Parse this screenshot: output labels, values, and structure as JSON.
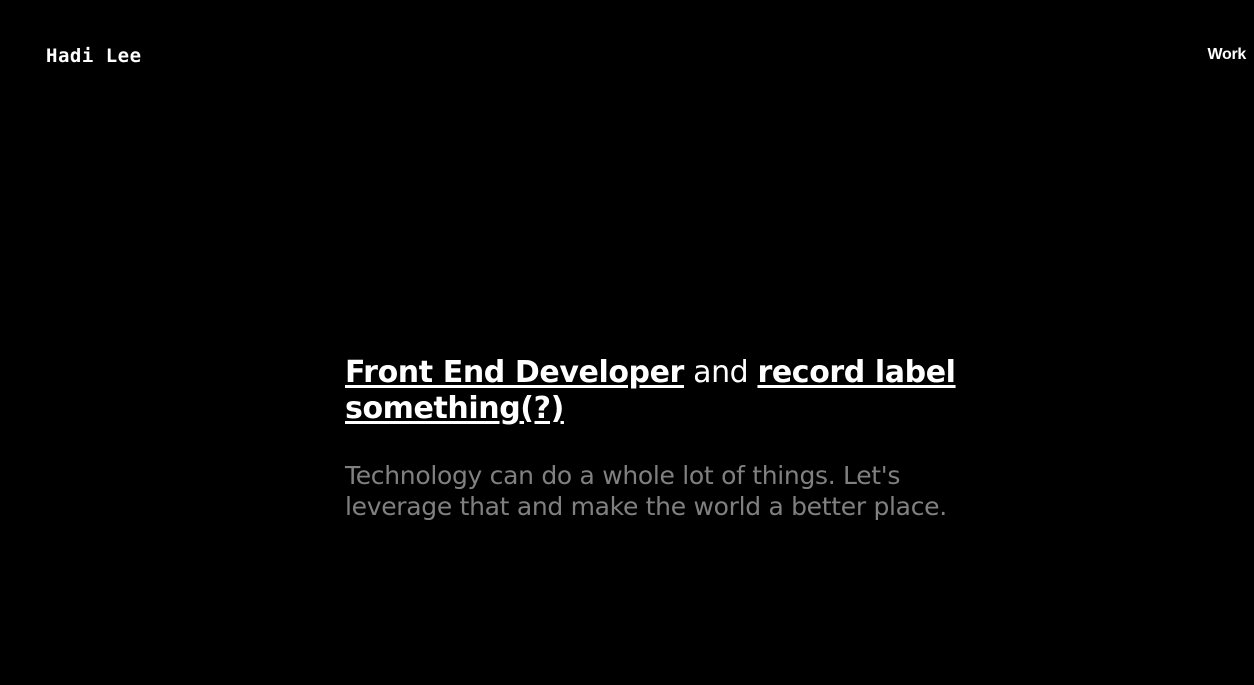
{
  "header": {
    "logo_text": "Hadi Lee",
    "nav_work_label": "Work"
  },
  "hero": {
    "link_front_end": "Front End Developer",
    "connector": " and ",
    "link_record_label": "record label something(?)",
    "tagline": "Technology can do a whole lot of things. Let's leverage that and make the world a better place."
  },
  "colors": {
    "background": "#000000",
    "text_primary": "#ffffff",
    "text_muted": "#808080"
  }
}
